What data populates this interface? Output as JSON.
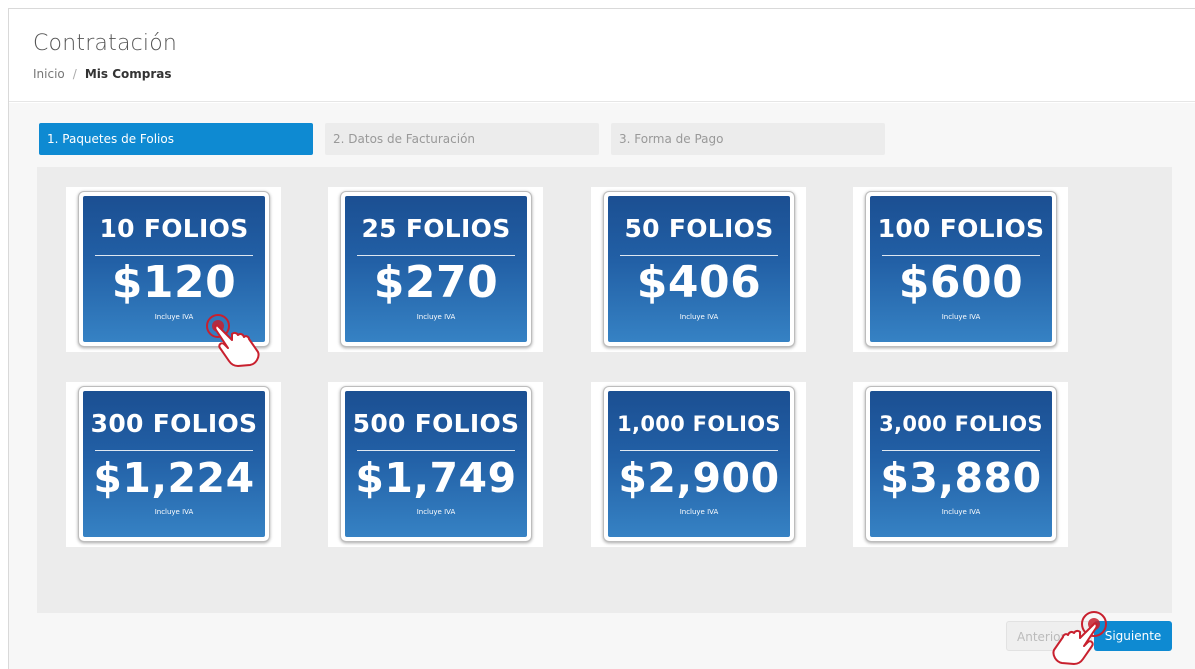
{
  "header": {
    "title": "Contratación",
    "breadcrumb": {
      "home": "Inicio",
      "separator": "/",
      "current": "Mis Compras"
    }
  },
  "steps": [
    {
      "label": "1. Paquetes de Folios",
      "active": true
    },
    {
      "label": "2. Datos de Facturación",
      "active": false
    },
    {
      "label": "3. Forma de Pago",
      "active": false
    }
  ],
  "packages": [
    {
      "folios": "10 FOLIOS",
      "price": "$120",
      "note": "Incluye IVA"
    },
    {
      "folios": "25 FOLIOS",
      "price": "$270",
      "note": "Incluye IVA"
    },
    {
      "folios": "50 FOLIOS",
      "price": "$406",
      "note": "Incluye IVA"
    },
    {
      "folios": "100 FOLIOS",
      "price": "$600",
      "note": "Incluye IVA"
    },
    {
      "folios": "300 FOLIOS",
      "price": "$1,224",
      "note": "Incluye IVA"
    },
    {
      "folios": "500 FOLIOS",
      "price": "$1,749",
      "note": "Incluye IVA"
    },
    {
      "folios": "1,000 FOLIOS",
      "price": "$2,900",
      "note": "Incluye IVA"
    },
    {
      "folios": "3,000 FOLIOS",
      "price": "$3,880",
      "note": "Incluye IVA"
    }
  ],
  "footer": {
    "prev_label": "Anterior",
    "next_label": "Siguiente"
  },
  "colors": {
    "accent": "#0e8ad2",
    "card_top": "#1b4f92",
    "card_bottom": "#3682c4",
    "pointer": "#c8202e"
  },
  "icons": {
    "pointer": "hand-pointer-icon"
  }
}
